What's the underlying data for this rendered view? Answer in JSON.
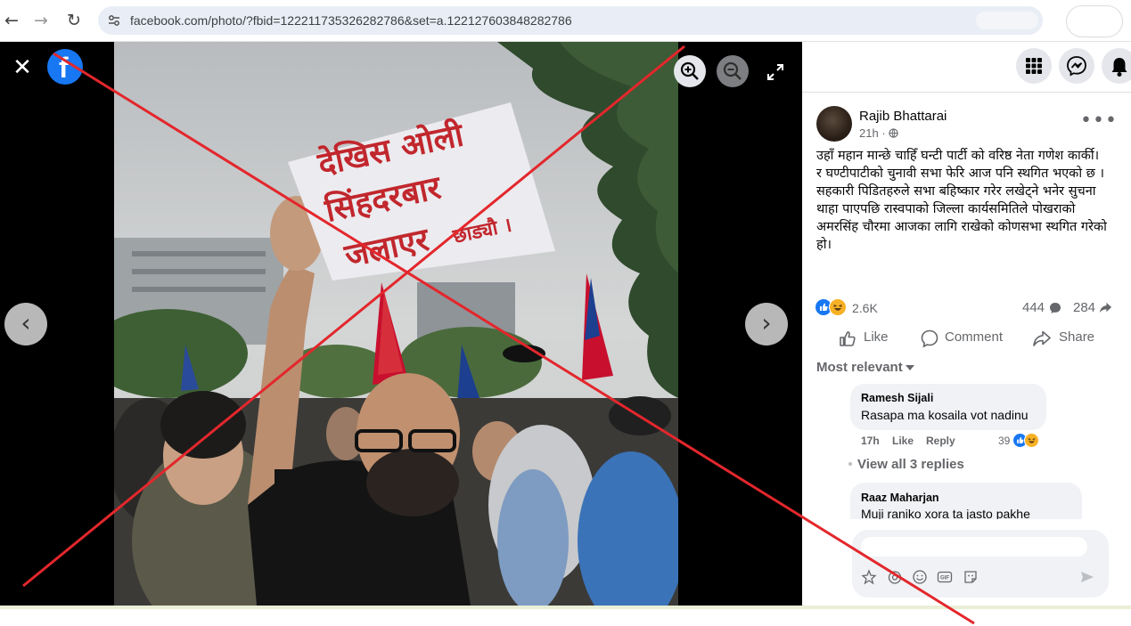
{
  "browser": {
    "url": "facebook.com/photo/?fbid=122211735326282786&set=a.122127603848282786",
    "back_icon": "back-arrow-icon",
    "forward_icon": "forward-arrow-icon",
    "reload_icon": "reload-icon"
  },
  "viewer": {
    "close_icon": "close-icon",
    "logo": "facebook-logo",
    "zoom_in_icon": "zoom-in-icon",
    "zoom_out_icon": "zoom-out-icon",
    "fullscreen_icon": "fullscreen-icon",
    "prev_icon": "chevron-left-icon",
    "next_icon": "chevron-right-icon",
    "photo": {
      "sign_line1": "देखिस ओली",
      "sign_line2": "सिंहदरबार",
      "sign_line3": "जलाएर",
      "sign_line4": "छाड्यौ ।"
    }
  },
  "header_icons": [
    "menu-grid-icon",
    "messenger-icon",
    "notifications-bell-icon"
  ],
  "post": {
    "author": "Rajib Bhattarai",
    "time": "21h",
    "audience_icon": "globe-icon",
    "text": "उहाँ महान मान्छे चाहिँ घन्टी पार्टी को वरिष्ठ नेता गणेश कार्की।\nर घण्टीपाटीको चुनावी सभा फेरि आज पनि स्थगित भएको छ । सहकारी पिडितहरुले सभा बहिष्कार गरेर लखेट्ने भनेर सुचना थाहा पाएपछि रास्वपाको जिल्ला कार्यसमितिले पोखराको अमरसिंह चौरमा आजका लागि राखेको कोणसभा स्थगित गरेको हो।",
    "reaction_count": "2.6K",
    "comment_count": "444",
    "share_count": "284",
    "actions": {
      "like": "Like",
      "comment": "Comment",
      "share": "Share"
    },
    "sort_label": "Most relevant"
  },
  "comments": [
    {
      "name": "Ramesh Sijali",
      "text": "Rasapa ma kosaila vot nadinu",
      "time": "17h",
      "like": "Like",
      "reply": "Reply",
      "reactions": "39"
    },
    {
      "name": "Raaz Maharjan",
      "text": "Muji raniko xora ta jasto pakhe"
    }
  ],
  "view_replies": "View all 3 replies",
  "composer": {
    "placeholder": "",
    "tools": [
      "avatar-sticker-icon",
      "camera-icon",
      "emoji-icon",
      "gif-icon",
      "sticker-icon",
      "send-icon"
    ]
  },
  "colors": {
    "facebook_blue": "#1877f2",
    "strike_red": "#e3272c",
    "secondary_text": "#65676b"
  }
}
